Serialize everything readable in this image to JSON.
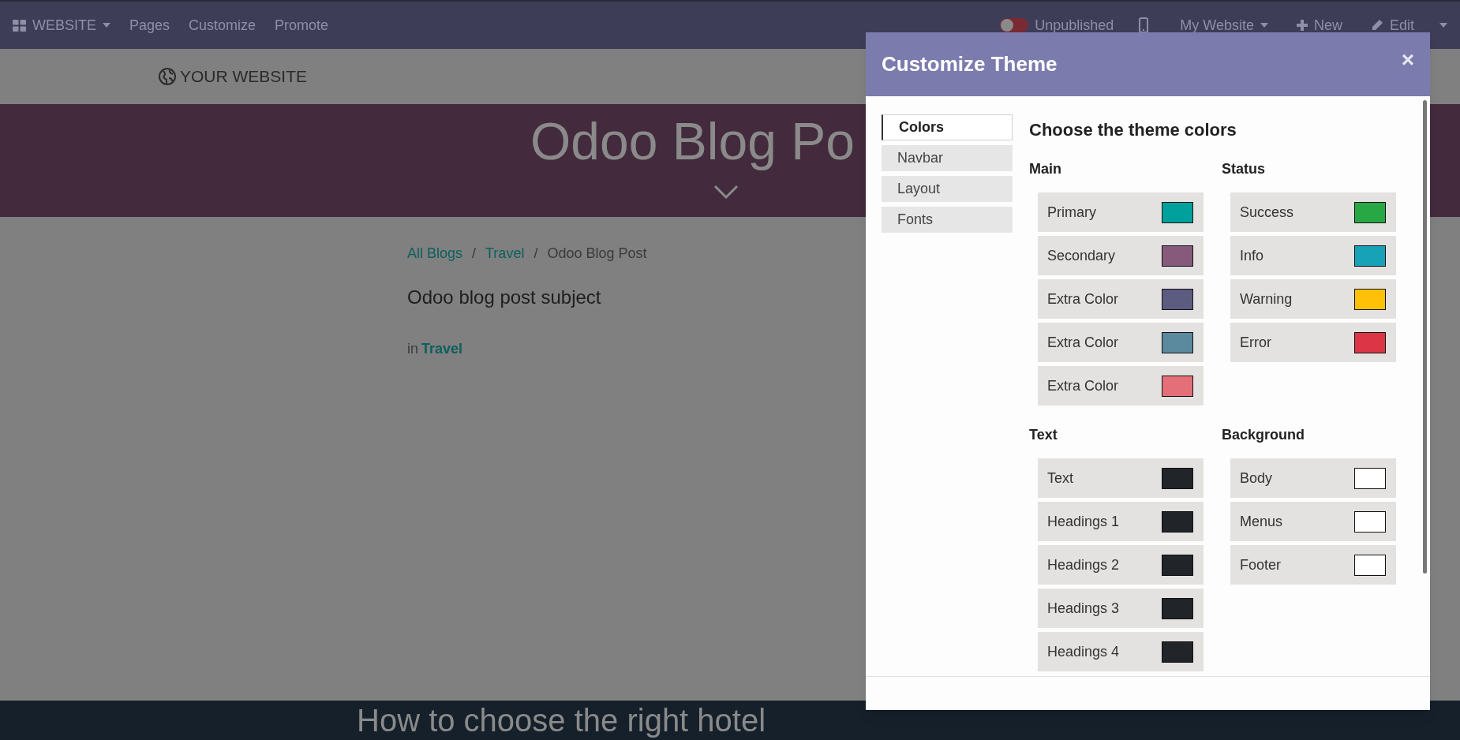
{
  "navbar": {
    "brand": "WEBSITE",
    "menu": [
      "Pages",
      "Customize",
      "Promote"
    ],
    "publish": {
      "label": "Unpublished",
      "on": false
    },
    "website": "My Website",
    "new": "New",
    "edit": "Edit"
  },
  "page": {
    "logo_text": "YOUR WEBSITE",
    "title": "Odoo Blog Po",
    "breadcrumb": [
      {
        "label": "All Blogs",
        "kind": "link"
      },
      {
        "label": "/",
        "kind": "separator"
      },
      {
        "label": "Travel",
        "kind": "link"
      },
      {
        "label": "/",
        "kind": "separator"
      },
      {
        "label": "Odoo Blog Post",
        "kind": "current"
      }
    ],
    "subtitle": "Odoo blog post subject",
    "category_prefix": "in",
    "category": "Travel",
    "next_title": "How to choose the right hotel"
  },
  "dialog": {
    "title": "Customize Theme",
    "close": "×",
    "tabs": [
      {
        "label": "Colors",
        "selected": true
      },
      {
        "label": "Navbar",
        "selected": false
      },
      {
        "label": "Layout",
        "selected": false
      },
      {
        "label": "Fonts",
        "selected": false
      }
    ],
    "heading": "Choose the theme colors",
    "groups": [
      {
        "title": "Main",
        "items": [
          {
            "label": "Primary",
            "color": "#00a09d"
          },
          {
            "label": "Secondary",
            "color": "#875a7b"
          },
          {
            "label": "Extra Color",
            "color": "#5c5b80"
          },
          {
            "label": "Extra Color",
            "color": "#5b899e"
          },
          {
            "label": "Extra Color",
            "color": "#e46f78"
          }
        ]
      },
      {
        "title": "Status",
        "items": [
          {
            "label": "Success",
            "color": "#28a745"
          },
          {
            "label": "Info",
            "color": "#17a2b8"
          },
          {
            "label": "Warning",
            "color": "#ffc107"
          },
          {
            "label": "Error",
            "color": "#dc3545"
          }
        ]
      },
      {
        "title": "Text",
        "items": [
          {
            "label": "Text",
            "color": "#212529"
          },
          {
            "label": "Headings 1",
            "color": "#212529"
          },
          {
            "label": "Headings 2",
            "color": "#212529"
          },
          {
            "label": "Headings 3",
            "color": "#212529"
          },
          {
            "label": "Headings 4",
            "color": "#212529"
          }
        ]
      },
      {
        "title": "Background",
        "items": [
          {
            "label": "Body",
            "color": "#ffffff"
          },
          {
            "label": "Menus",
            "color": "#ffffff"
          },
          {
            "label": "Footer",
            "color": "#ffffff"
          }
        ]
      }
    ]
  }
}
